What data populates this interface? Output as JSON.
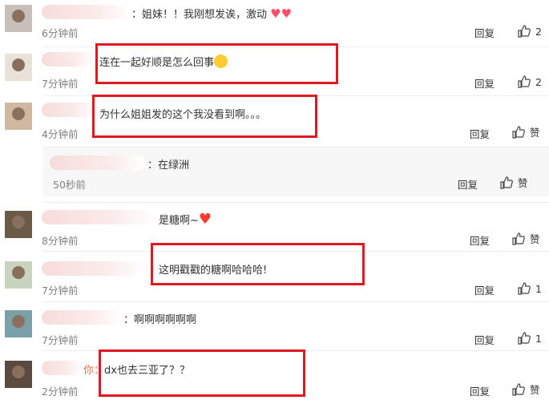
{
  "comments": [
    {
      "name_suffix": "：",
      "text": "姐妹！！我刚想发诶，激动",
      "time": "6分钟前",
      "reply": "回复",
      "likes": "2"
    },
    {
      "name_suffix": "：",
      "text": "连在一起好顺是怎么回事",
      "time": "7分钟前",
      "reply": "回复",
      "likes": "2"
    },
    {
      "name_suffix": "：",
      "text": "为什么姐姐发的这个我没看到啊。。。",
      "time": "4分钟前",
      "reply": "回复",
      "likes": "赞"
    },
    {
      "name_suffix": "：",
      "text": "在绿洲",
      "time": "50秒前",
      "reply": "回复",
      "likes": "赞"
    },
    {
      "name_suffix": "",
      "text": "是糖啊~",
      "time": "8分钟前",
      "reply": "回复",
      "likes": "赞"
    },
    {
      "name_suffix": "",
      "text": "这明戳戳的糖啊哈哈哈!",
      "time": "7分钟前",
      "reply": "回复",
      "likes": "1"
    },
    {
      "name_suffix": "：",
      "text": "啊啊啊啊啊啊",
      "time": "7分钟前",
      "reply": "回复",
      "likes": "1"
    },
    {
      "name_suffix": "你：",
      "text": "dx也去三亚了？？",
      "time": "2分钟前",
      "reply": "回复",
      "likes": "赞"
    }
  ],
  "icons": {
    "like": "thumbs-up-icon",
    "heart": "heart-icon",
    "emoji": "laughing-emoji-icon"
  },
  "colors": {
    "highlight_box": "#e01822",
    "timestamp": "#808080"
  }
}
